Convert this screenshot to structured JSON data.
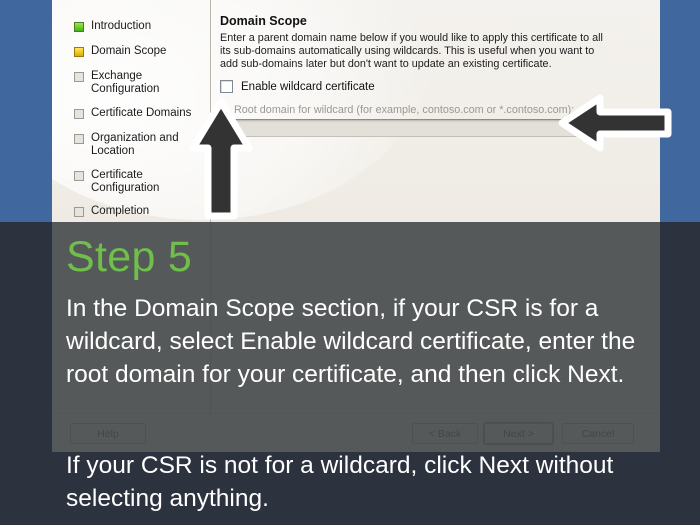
{
  "colors": {
    "desktop_blue": "#41679f",
    "overlay_slate": "#414957",
    "step_green": "#6fbf4a",
    "dialog_face": "#efece6",
    "caption_white": "#ffffff"
  },
  "dialog": {
    "sidebar": {
      "items": [
        {
          "label": "Introduction",
          "state": "done"
        },
        {
          "label": "Domain Scope",
          "state": "current"
        },
        {
          "label": "Exchange\nConfiguration",
          "state": "pending"
        },
        {
          "label": "Certificate Domains",
          "state": "pending"
        },
        {
          "label": "Organization and\nLocation",
          "state": "pending"
        },
        {
          "label": "Certificate\nConfiguration",
          "state": "pending"
        },
        {
          "label": "Completion",
          "state": "pending"
        }
      ]
    },
    "pane": {
      "title": "Domain Scope",
      "description": "Enter a parent domain name below if you would like to apply this certificate to all its sub-domains automatically using wildcards. This is useful when you want to add sub-domains later but don't want to update an existing certificate.",
      "wildcard_checkbox_label": "Enable wildcard certificate",
      "wildcard_checked": false,
      "root_domain_label": "Root domain for wildcard (for example, contoso.com or *.contoso.com):",
      "root_domain_value": "",
      "root_domain_enabled": false
    },
    "buttons": {
      "help": "Help",
      "back": "< Back",
      "next": "Next >",
      "cancel": "Cancel",
      "default_button": "Next >"
    }
  },
  "annotations": {
    "arrow_up": "up-arrow-annotation",
    "arrow_left": "left-arrow-annotation"
  },
  "caption": {
    "step_title": "Step 5",
    "body": "In the Domain Scope section, if your CSR is for a wildcard, select Enable wildcard certificate, enter the root domain for your certificate, and then click Next.",
    "footer": "If your CSR is not for a wildcard, click Next without selecting anything."
  }
}
